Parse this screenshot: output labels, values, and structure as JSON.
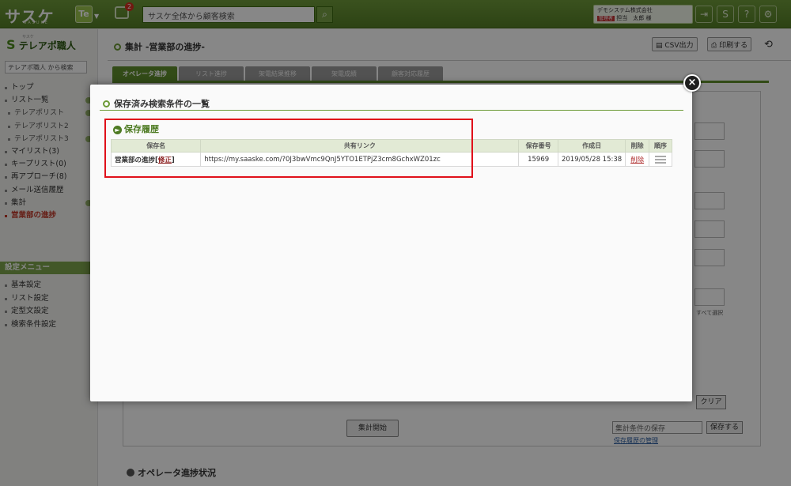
{
  "header": {
    "logo": "サスケ",
    "logo_sub": "SASUKE",
    "app_badge": "Te",
    "notification_count": "2",
    "search_placeholder": "サスケ全体から顧客検索",
    "company_name": "デモシステム株式会社",
    "role_tag": "管理者",
    "user_name": "担当　太郎 様"
  },
  "sidebar": {
    "brand_ruby": "サスケ",
    "brand": "テレアポ職人",
    "search_placeholder": "テレアポ職人 から検索",
    "items": [
      {
        "label": "トップ"
      },
      {
        "label": "リスト一覧"
      },
      {
        "label": "テレアポリスト"
      },
      {
        "label": "テレアポリスト2"
      },
      {
        "label": "テレアポリスト3"
      },
      {
        "label": "マイリスト(3)"
      },
      {
        "label": "キープリスト(0)"
      },
      {
        "label": "再アプローチ(8)"
      },
      {
        "label": "メール送信履歴"
      },
      {
        "label": "集計"
      },
      {
        "label": "営業部の進捗"
      }
    ],
    "settings_section": "設定メニュー",
    "settings_items": [
      {
        "label": "基本設定"
      },
      {
        "label": "リスト設定"
      },
      {
        "label": "定型文設定"
      },
      {
        "label": "検索条件設定"
      }
    ]
  },
  "main": {
    "title": "集計 -営業部の進捗-",
    "csv_button": "CSV出力",
    "print_button": "印刷する",
    "tabs": [
      {
        "label": "オペレータ進捗"
      },
      {
        "label": "リスト進捗"
      },
      {
        "label": "架電結果推移"
      },
      {
        "label": "架電成績"
      },
      {
        "label": "顧客対応履歴"
      }
    ],
    "clear_button": "クリア",
    "select_all": "すべて選択",
    "start_button": "集計開始",
    "save_condition_placeholder": "集計条件の保存",
    "save_button": "保存する",
    "save_history_link": "保存履歴の管理",
    "operator_section": "オペレータ進捗状況"
  },
  "modal": {
    "title": "保存済み検索条件の一覧",
    "close": "×",
    "history_title": "保存履歴",
    "columns": [
      "保存名",
      "共有リンク",
      "保存番号",
      "作成日",
      "削除",
      "順序"
    ],
    "rows": [
      {
        "name": "営業部の進捗",
        "edit": "修正",
        "link": "https://my.saaske.com/?0J3bwVmc9QnJ5YTO1ETPjZ3cm8GchxWZ01zc",
        "number": "15969",
        "created": "2019/05/28 15:38",
        "delete": "削除"
      }
    ]
  },
  "colors": {
    "brand_green": "#5f8f2c",
    "highlight_red": "#e0101a"
  }
}
